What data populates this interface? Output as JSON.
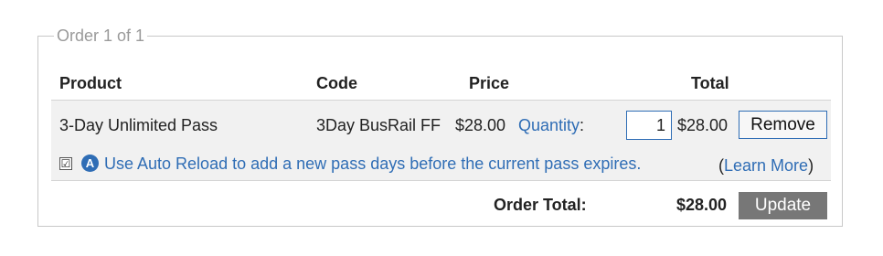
{
  "order": {
    "legend": "Order 1 of 1",
    "headers": {
      "product": "Product",
      "code": "Code",
      "price": "Price",
      "total": "Total"
    },
    "item": {
      "product": "3-Day Unlimited Pass",
      "code": "3Day BusRail FF",
      "price": "$28.00",
      "quantity_label": "Quantity",
      "quantity_colon": ":",
      "quantity_value": "1",
      "line_total": "$28.00",
      "remove_label": "Remove"
    },
    "auto_reload": {
      "icon_letter": "A",
      "checkbox_mark": "☑",
      "text": "Use Auto Reload to add a new pass days before the current pass expires.",
      "learn_more_open": "(",
      "learn_more": "Learn More",
      "learn_more_close": ")"
    },
    "footer": {
      "order_total_label": "Order Total:",
      "order_total_value": "$28.00",
      "update_label": "Update"
    }
  },
  "colors": {
    "link": "#2f6db5",
    "border": "#c8c8c8",
    "row_bg": "#f1f1f1",
    "update_bg": "#777777"
  }
}
